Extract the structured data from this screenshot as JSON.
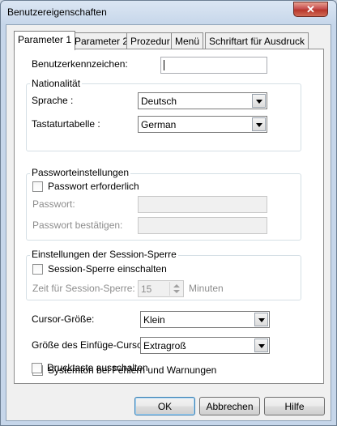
{
  "window": {
    "title": "Benutzereigenschaften",
    "close_glyph": "✕"
  },
  "tabs": [
    "Parameter 1",
    "Parameter 2",
    "Prozedur",
    "Menü",
    "Schriftart für Ausdruck"
  ],
  "user_id": {
    "label": "Benutzerkennzeichen:",
    "value": ""
  },
  "nationality": {
    "legend": "Nationalität",
    "language_label": "Sprache :",
    "language_value": "Deutsch",
    "keyboard_label": "Tastaturtabelle :",
    "keyboard_value": "German"
  },
  "password": {
    "legend": "Passworteinstellungen",
    "required_label": "Passwort erforderlich",
    "required_checked": false,
    "password_label": "Passwort:",
    "confirm_label": "Passwort bestätigen:"
  },
  "session_lock": {
    "legend": "Einstellungen der Session-Sperre",
    "enable_label": "Session-Sperre einschalten",
    "enable_checked": false,
    "time_label": "Zeit für Session-Sperre:",
    "time_value": "15",
    "time_unit": "Minuten"
  },
  "cursor_size": {
    "label": "Cursor-Größe:",
    "value": "Klein"
  },
  "insert_cursor_size": {
    "label": "Größe des Einfüge-Cursors:",
    "value": "Extragroß"
  },
  "system_sound": {
    "label": "Systemton bei Fehlern und Warnungen",
    "checked": true
  },
  "print_key": {
    "label": "Drucktaste ausschalten",
    "checked": false
  },
  "buttons": {
    "ok": "OK",
    "cancel": "Abbrechen",
    "help": "Hilfe"
  }
}
